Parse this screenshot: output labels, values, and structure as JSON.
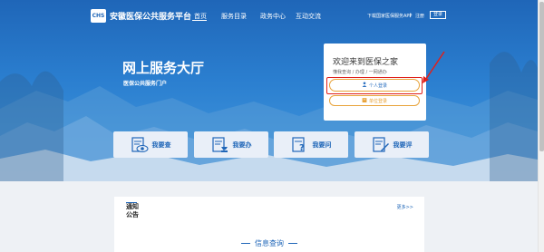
{
  "header": {
    "logo_badge": "CHS",
    "title": "安徽医保公共服务平台",
    "nav": [
      "首页",
      "服务目录",
      "政务中心",
      "互动交流"
    ],
    "active_nav_index": 0,
    "download_text": "下载国家医保服务APP",
    "divider": "|",
    "register": "注册",
    "login": "登录"
  },
  "hero": {
    "title": "网上服务大厅",
    "subtitle": "医保公共服务门户"
  },
  "welcome": {
    "title": "欢迎来到医保之家",
    "tip": "懂我查询 / 办理 / 一网通办",
    "personal_login": "个人登录",
    "org_login": "单位登录"
  },
  "services": [
    {
      "label": "我要查",
      "icon": "eye-document-icon"
    },
    {
      "label": "我要办",
      "icon": "stamp-document-icon"
    },
    {
      "label": "我要问",
      "icon": "question-document-icon"
    },
    {
      "label": "我要评",
      "icon": "edit-document-icon"
    }
  ],
  "notice": {
    "title_line1": "通知",
    "title_line2": "公告",
    "more": "更多>>"
  },
  "info_query": "信息查询",
  "colors": {
    "brand_blue": "#1f66b8",
    "accent_orange": "#e8a33a",
    "highlight_red": "#e0201b"
  }
}
